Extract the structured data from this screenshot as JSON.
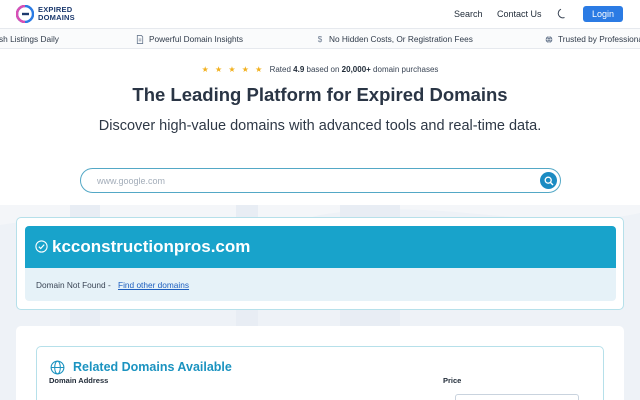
{
  "header": {
    "logo_line1": "EXPIRED",
    "logo_line2": "DOMAINS",
    "nav_search": "Search",
    "nav_contact": "Contact Us",
    "login_label": "Login",
    "theme_icon": "moon-icon"
  },
  "strip": {
    "items": [
      {
        "label": "sh Listings Daily",
        "icon": "none"
      },
      {
        "label": "Powerful Domain Insights",
        "icon": "document-icon"
      },
      {
        "label": "No Hidden Costs, Or Registration Fees",
        "icon": "dollar-icon"
      },
      {
        "label": "Trusted by Professiona",
        "icon": "globe-icon"
      }
    ]
  },
  "rating": {
    "stars": "★ ★ ★ ★ ★",
    "prefix": "Rated",
    "score": "4.9",
    "middle": "based on",
    "count": "20,000+",
    "suffix": "domain purchases"
  },
  "hero": {
    "title": "The Leading Platform for Expired Domains",
    "subtitle": "Discover high-value domains with advanced tools and real-time data."
  },
  "search": {
    "placeholder": "www.google.com",
    "value": ""
  },
  "result": {
    "domain": "kcconstructionpros.com",
    "status": "Domain Not Found -",
    "link": "Find other domains"
  },
  "related": {
    "title": "Related Domains Available",
    "col_domain": "Domain Address",
    "col_price": "Price"
  },
  "colors": {
    "accent": "#18a3cb",
    "login": "#2b7be4",
    "star": "#f2b01e"
  }
}
